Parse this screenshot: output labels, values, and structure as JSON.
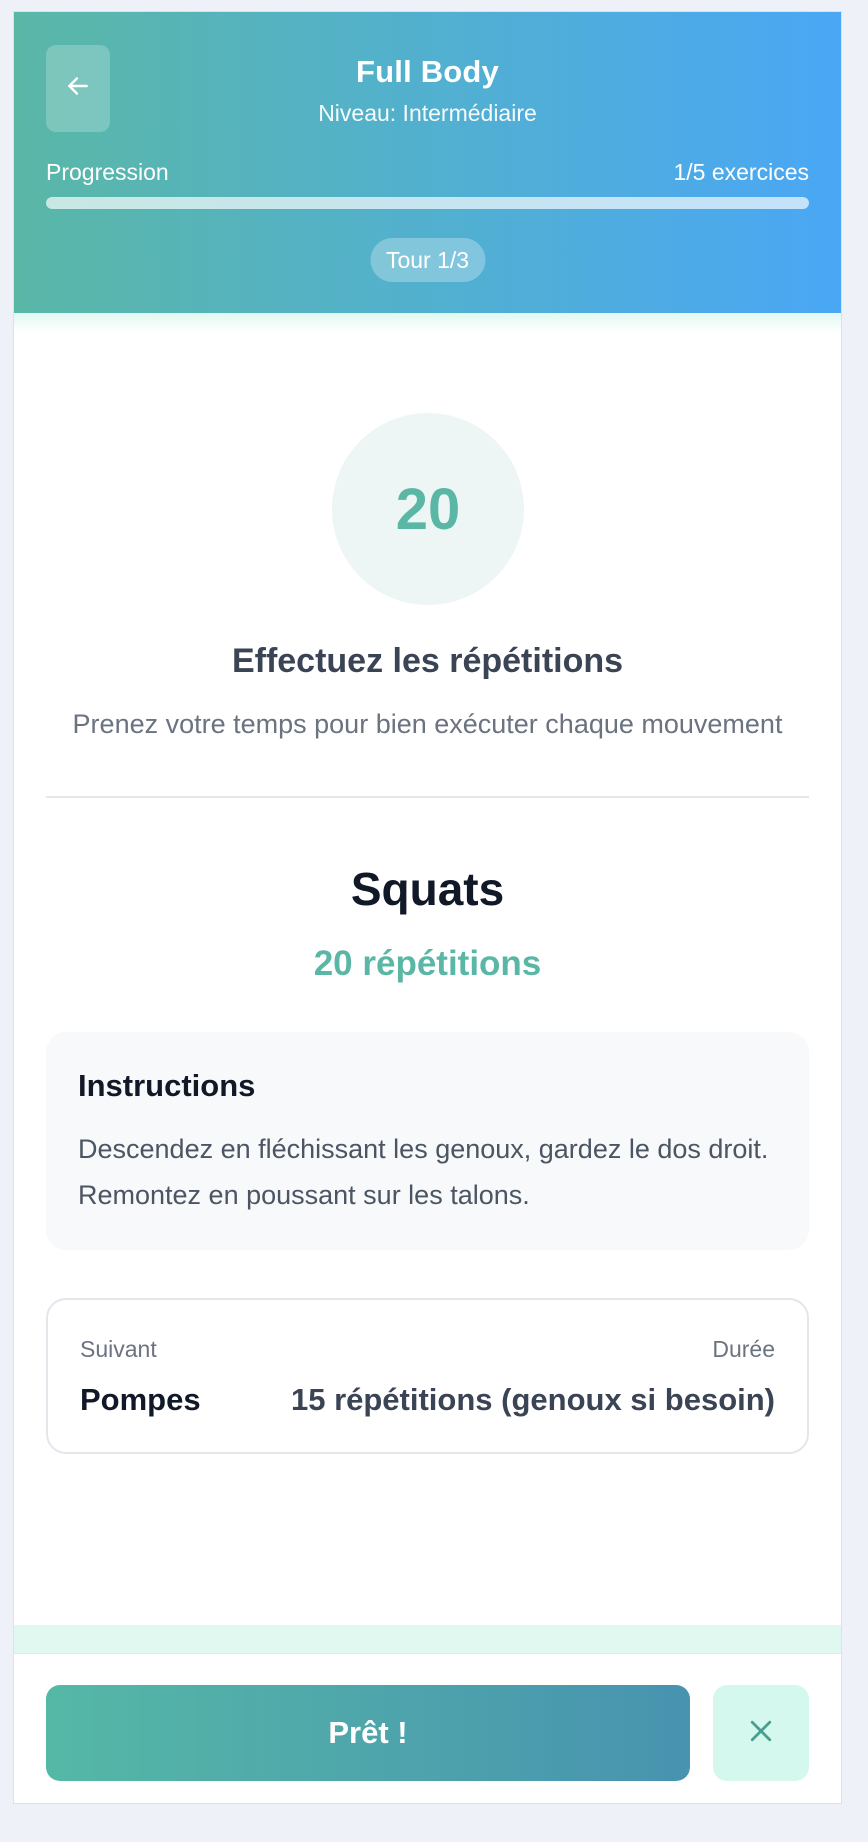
{
  "header": {
    "title": "Full Body",
    "level": "Niveau: Intermédiaire",
    "progress_label": "Progression",
    "progress_count": "1/5 exercices",
    "progress_fraction": 1.0,
    "round_badge": "Tour 1/3",
    "back_icon": "arrow-left-icon"
  },
  "current": {
    "rep_count": "20",
    "instruction_title": "Effectuez les répétitions",
    "instruction_subtitle": "Prenez votre temps pour bien exécuter chaque mouvement",
    "exercise_name": "Squats",
    "exercise_reps": "20 répétitions"
  },
  "instructions_card": {
    "heading": "Instructions",
    "text": "Descendez en fléchissant les genoux, gardez le dos droit. Remontez en poussant sur les talons."
  },
  "next_card": {
    "next_label": "Suivant",
    "duration_label": "Durée",
    "next_name": "Pompes",
    "next_duration": "15 répétitions (genoux si besoin)"
  },
  "footer": {
    "ready_label": "Prêt !",
    "close_icon": "close-icon"
  },
  "colors": {
    "accent": "#5ab7a6",
    "header_gradient_start": "#5ab7a6",
    "header_gradient_end": "#4aa7f5",
    "mint": "#d4f7ee"
  }
}
